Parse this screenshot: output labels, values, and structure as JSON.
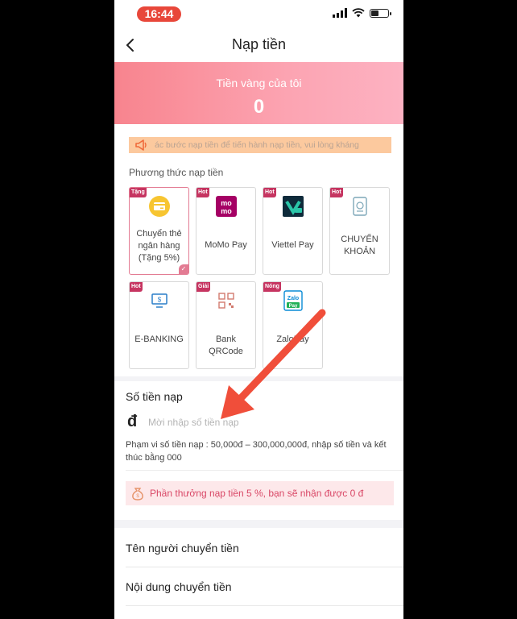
{
  "status_bar": {
    "time": "16:44"
  },
  "nav": {
    "title": "Nạp tiền"
  },
  "banner": {
    "label": "Tiền vàng của tôi",
    "value": "0"
  },
  "notice": {
    "text": "ác bước nạp tiền để tiến hành nạp tiền, vui lòng kháng"
  },
  "methods": {
    "section_label": "Phương thức nạp tiền",
    "items": [
      {
        "tag": "Tặng",
        "label": "Chuyển thẻ ngân hàng (Tặng 5%)",
        "icon": "bank-card-icon",
        "selected": true
      },
      {
        "tag": "Hot",
        "label": "MoMo Pay",
        "icon": "momo-icon"
      },
      {
        "tag": "Hot",
        "label": "Viettel Pay",
        "icon": "viettel-pay-icon"
      },
      {
        "tag": "Hot",
        "label": "CHUYỂN KHOẢN",
        "icon": "transfer-icon"
      },
      {
        "tag": "Hot",
        "label": "E-BANKING",
        "icon": "monitor-icon"
      },
      {
        "tag": "Giải",
        "label": "Bank QRCode",
        "icon": "qr-code-icon"
      },
      {
        "tag": "Nóng",
        "label": "ZaloPay",
        "icon": "zalopay-icon"
      }
    ]
  },
  "amount": {
    "title": "Số tiền nạp",
    "currency_symbol": "đ",
    "placeholder": "Mời nhập số tiền nạp",
    "range_text": "Phạm vi số tiền nạp : 50,000đ – 300,000,000đ, nhập số tiền và kết thúc bằng 000",
    "bonus_text": "Phần thưởng nạp tiền 5 %, bạn sẽ nhận được 0 đ"
  },
  "transfer": {
    "sender_label": "Tên người chuyển tiền",
    "content_label": "Nội dung chuyển tiền"
  },
  "colors": {
    "accent": "#e37b93",
    "tag": "#c63561",
    "banner_start": "#f8848e",
    "arrow": "#f04e3a"
  }
}
